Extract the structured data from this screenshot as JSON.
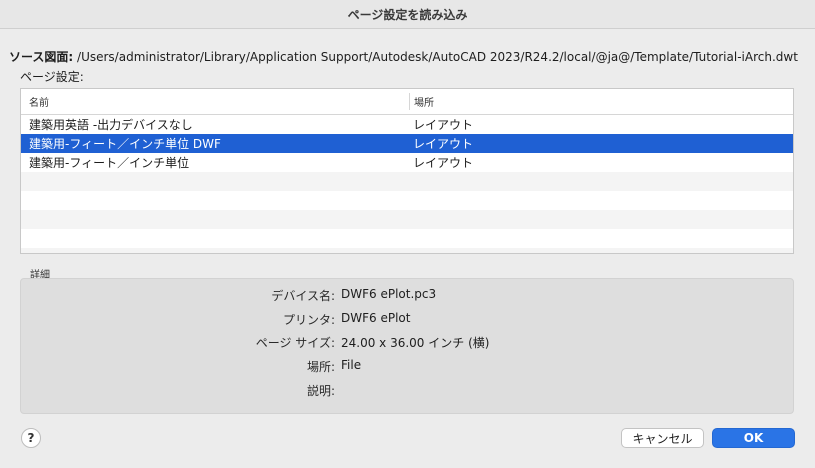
{
  "window": {
    "title": "ページ設定を読み込み"
  },
  "source": {
    "label": "ソース図面:",
    "path": "/Users/administrator/Library/Application Support/Autodesk/AutoCAD 2023/R24.2/local/@ja@/Template/Tutorial-iArch.dwt"
  },
  "page_setups": {
    "label": "ページ設定:",
    "columns": {
      "name": "名前",
      "location": "場所"
    },
    "rows": [
      {
        "name": "建築用英語 -出力デバイスなし",
        "location": "レイアウト"
      },
      {
        "name": "建築用-フィート／インチ単位 DWF",
        "location": "レイアウト"
      },
      {
        "name": "建築用-フィート／インチ単位",
        "location": "レイアウト"
      }
    ]
  },
  "details": {
    "label": "詳細",
    "fields": [
      {
        "key": "デバイス名:",
        "value": "DWF6 ePlot.pc3"
      },
      {
        "key": "プリンタ:",
        "value": "DWF6 ePlot"
      },
      {
        "key": "ページ サイズ:",
        "value": "24.00 x 36.00 インチ (横)"
      },
      {
        "key": "場所:",
        "value": "File"
      },
      {
        "key": "説明:",
        "value": ""
      }
    ]
  },
  "buttons": {
    "help": "?",
    "cancel": "キャンセル",
    "ok": "OK"
  }
}
